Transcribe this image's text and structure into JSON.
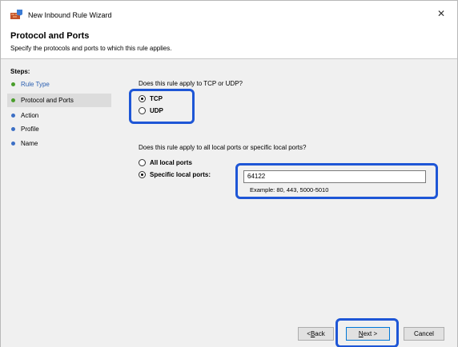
{
  "window": {
    "title": "New Inbound Rule Wizard",
    "close_glyph": "✕"
  },
  "header": {
    "title": "Protocol and Ports",
    "subtitle": "Specify the protocols and ports to which this rule applies."
  },
  "steps": {
    "heading": "Steps:",
    "items": [
      {
        "label": "Rule Type",
        "state": "link"
      },
      {
        "label": "Protocol and Ports",
        "state": "active"
      },
      {
        "label": "Action",
        "state": "pending"
      },
      {
        "label": "Profile",
        "state": "pending"
      },
      {
        "label": "Name",
        "state": "pending"
      }
    ]
  },
  "protocol": {
    "question": "Does this rule apply to TCP or UDP?",
    "options": [
      {
        "label": "TCP",
        "checked": true
      },
      {
        "label": "UDP",
        "checked": false
      }
    ]
  },
  "ports": {
    "question": "Does this rule apply to all local ports or specific local ports?",
    "options": [
      {
        "label": "All local ports",
        "checked": false
      },
      {
        "label": "Specific local ports:",
        "checked": true
      }
    ],
    "value": "64122",
    "example": "Example: 80, 443, 5000-5010"
  },
  "buttons": {
    "back_prefix": "< ",
    "back_accel": "B",
    "back_rest": "ack",
    "next_accel": "N",
    "next_rest": "ext >",
    "cancel": "Cancel"
  },
  "colors": {
    "highlight": "#1e56d6",
    "step_done": "#4a9e2c",
    "step_pending": "#3c6fc5",
    "link": "#2a5fb0"
  }
}
